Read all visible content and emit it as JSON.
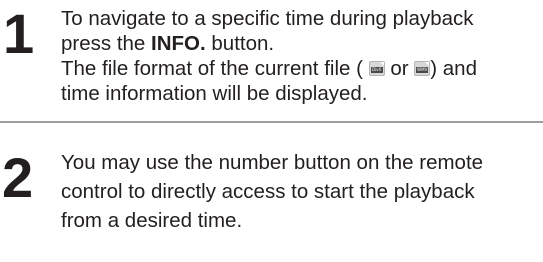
{
  "steps": [
    {
      "number": "1",
      "line1": "To navigate to a specific time during playback",
      "line2_pre": "press the ",
      "line2_bold": "INFO.",
      "line2_post": " button.",
      "line3_pre": "The file format of the current file ( ",
      "line3_mid": " or ",
      "line3_post": ") and",
      "line4": "time information will be displayed.",
      "icons": [
        {
          "name": "divx-file-icon",
          "label": "DivX"
        },
        {
          "name": "wmv-file-icon",
          "label": "WMV"
        }
      ]
    },
    {
      "number": "2",
      "line1": "You may use the number button on the remote",
      "line2": "control to directly access to start the playback",
      "line3": "from a desired time."
    }
  ]
}
